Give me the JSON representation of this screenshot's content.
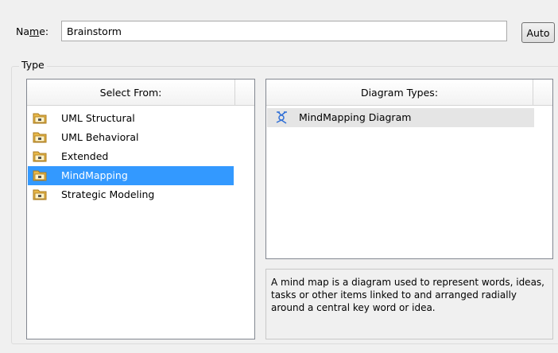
{
  "name": {
    "label_prefix": "Na",
    "label_mnemonic": "m",
    "label_suffix": "e:",
    "value": "Brainstorm",
    "auto_label": "Auto"
  },
  "type_group": {
    "label": "Type"
  },
  "select_from": {
    "header": "Select From:",
    "items": [
      {
        "label": "UML Structural",
        "icon": "package-folder-icon",
        "selected": false
      },
      {
        "label": "UML Behavioral",
        "icon": "package-folder-icon",
        "selected": false
      },
      {
        "label": "Extended",
        "icon": "package-folder-icon",
        "selected": false
      },
      {
        "label": "MindMapping",
        "icon": "package-folder-icon",
        "selected": true
      },
      {
        "label": "Strategic Modeling",
        "icon": "package-folder-icon",
        "selected": false
      }
    ]
  },
  "diagram_types": {
    "header": "Diagram Types:",
    "items": [
      {
        "label": "MindMapping Diagram",
        "icon": "mindmap-diagram-icon"
      }
    ]
  },
  "description": "A mind map is a diagram used to represent words, ideas, tasks or other items linked to and arranged radially around a central key word or idea.",
  "colors": {
    "selection": "#3399ff",
    "folder": "#e8b84a",
    "folder_dark": "#a97a1c",
    "mindmap_icon": "#2f6fd6"
  }
}
